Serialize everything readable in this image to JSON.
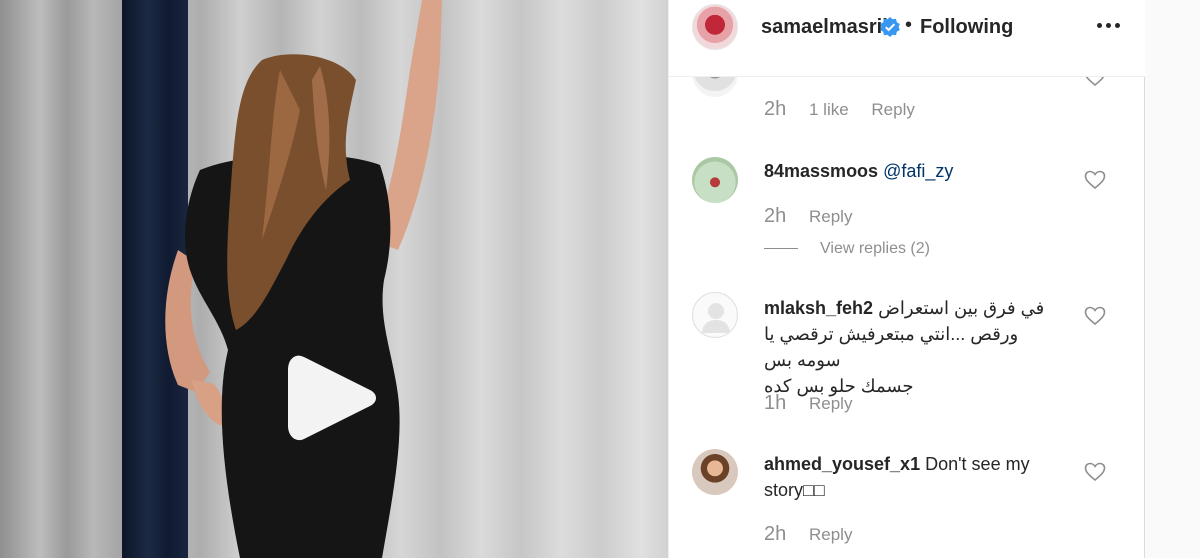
{
  "post": {
    "username": "samaelmasrii",
    "separator": "•",
    "follow_status": "Following"
  },
  "comments": [
    {
      "time": "2h",
      "likes": "1 like",
      "reply": "Reply"
    },
    {
      "username": "84massmoos",
      "mention": "@fafi_zy",
      "time": "2h",
      "reply": "Reply",
      "view_replies": "View replies (2)"
    },
    {
      "username": "mlaksh_feh2",
      "line1": "في فرق بين استعراض",
      "line2": "ورقص ...انتي مبتعرفيش ترقصي يا سومه بس",
      "line3": "جسمك حلو بس كده",
      "time": "1h",
      "reply": "Reply"
    },
    {
      "username": "ahmed_yousef_x1",
      "text": "Don't see my",
      "text2": "story□□",
      "time": "2h",
      "reply": "Reply"
    }
  ],
  "colors": {
    "verified": "#3897f0",
    "mention": "#003569",
    "meta": "#8e8e8e"
  }
}
